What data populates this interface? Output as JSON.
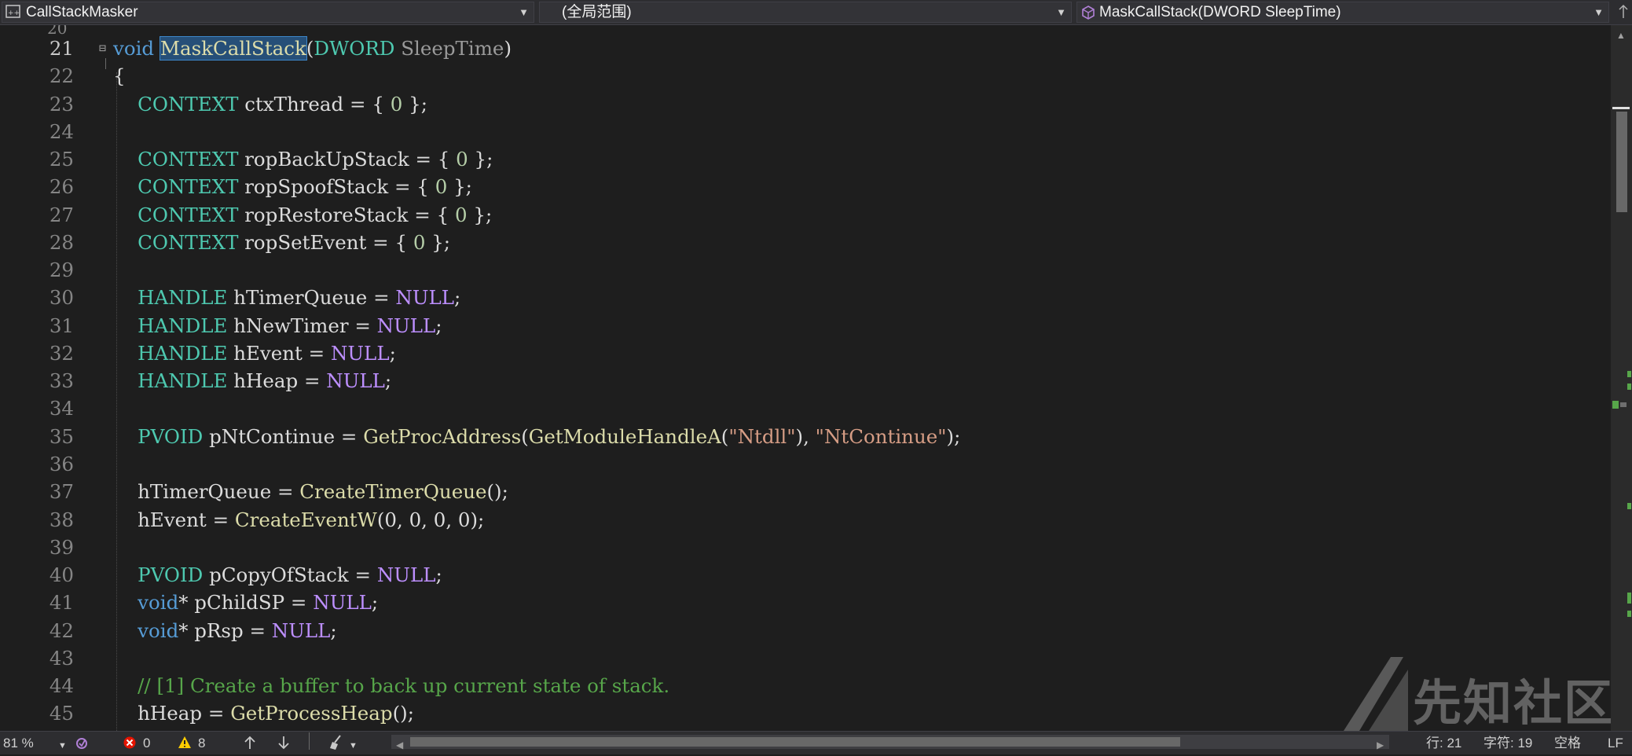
{
  "navbar": {
    "project": "CallStackMasker",
    "scope": "(全局范围)",
    "member": "MaskCallStack(DWORD SleepTime)",
    "project_icon": "cpp-project-icon",
    "member_icon": "method-cube-icon",
    "dropdown_icon": "chevron-down-icon"
  },
  "editor": {
    "current_line": 21,
    "lines": [
      {
        "num": "21",
        "tokens": [
          {
            "c": "kw",
            "t": "void "
          },
          {
            "c": "fn sel",
            "t": "MaskCallStack"
          },
          {
            "c": "pl",
            "t": "("
          },
          {
            "c": "ty",
            "t": "DWORD "
          },
          {
            "c": "pm",
            "t": "SleepTime"
          },
          {
            "c": "pl",
            "t": ")"
          }
        ]
      },
      {
        "num": "22",
        "tokens": [
          {
            "c": "pl",
            "t": "{"
          }
        ]
      },
      {
        "num": "23",
        "tokens": [
          {
            "c": "ty",
            "t": "    CONTEXT "
          },
          {
            "c": "pl",
            "t": "ctxThread = { "
          },
          {
            "c": "nm",
            "t": "0"
          },
          {
            "c": "pl",
            "t": " };"
          }
        ]
      },
      {
        "num": "24",
        "tokens": []
      },
      {
        "num": "25",
        "tokens": [
          {
            "c": "ty",
            "t": "    CONTEXT "
          },
          {
            "c": "pl",
            "t": "ropBackUpStack = { "
          },
          {
            "c": "nm",
            "t": "0"
          },
          {
            "c": "pl",
            "t": " };"
          }
        ]
      },
      {
        "num": "26",
        "tokens": [
          {
            "c": "ty",
            "t": "    CONTEXT "
          },
          {
            "c": "pl",
            "t": "ropSpoofStack = { "
          },
          {
            "c": "nm",
            "t": "0"
          },
          {
            "c": "pl",
            "t": " };"
          }
        ]
      },
      {
        "num": "27",
        "tokens": [
          {
            "c": "ty",
            "t": "    CONTEXT "
          },
          {
            "c": "pl",
            "t": "ropRestoreStack = { "
          },
          {
            "c": "nm",
            "t": "0"
          },
          {
            "c": "pl",
            "t": " };"
          }
        ]
      },
      {
        "num": "28",
        "tokens": [
          {
            "c": "ty",
            "t": "    CONTEXT "
          },
          {
            "c": "pl",
            "t": "ropSetEvent = { "
          },
          {
            "c": "nm",
            "t": "0"
          },
          {
            "c": "pl",
            "t": " };"
          }
        ]
      },
      {
        "num": "29",
        "tokens": []
      },
      {
        "num": "30",
        "tokens": [
          {
            "c": "ty",
            "t": "    HANDLE "
          },
          {
            "c": "pl",
            "t": "hTimerQueue = "
          },
          {
            "c": "mc",
            "t": "NULL"
          },
          {
            "c": "pl",
            "t": ";"
          }
        ]
      },
      {
        "num": "31",
        "tokens": [
          {
            "c": "ty",
            "t": "    HANDLE "
          },
          {
            "c": "pl",
            "t": "hNewTimer = "
          },
          {
            "c": "mc",
            "t": "NULL"
          },
          {
            "c": "pl",
            "t": ";"
          }
        ]
      },
      {
        "num": "32",
        "tokens": [
          {
            "c": "ty",
            "t": "    HANDLE "
          },
          {
            "c": "pl",
            "t": "hEvent = "
          },
          {
            "c": "mc",
            "t": "NULL"
          },
          {
            "c": "pl",
            "t": ";"
          }
        ]
      },
      {
        "num": "33",
        "tokens": [
          {
            "c": "ty",
            "t": "    HANDLE "
          },
          {
            "c": "pl",
            "t": "hHeap = "
          },
          {
            "c": "mc",
            "t": "NULL"
          },
          {
            "c": "pl",
            "t": ";"
          }
        ]
      },
      {
        "num": "34",
        "tokens": []
      },
      {
        "num": "35",
        "tokens": [
          {
            "c": "ty",
            "t": "    PVOID "
          },
          {
            "c": "pl",
            "t": "pNtContinue = "
          },
          {
            "c": "fn",
            "t": "GetProcAddress"
          },
          {
            "c": "pl",
            "t": "("
          },
          {
            "c": "fn",
            "t": "GetModuleHandleA"
          },
          {
            "c": "pl",
            "t": "("
          },
          {
            "c": "st",
            "t": "\"Ntdll\""
          },
          {
            "c": "pl",
            "t": "), "
          },
          {
            "c": "st",
            "t": "\"NtContinue\""
          },
          {
            "c": "pl",
            "t": ");"
          }
        ]
      },
      {
        "num": "36",
        "tokens": []
      },
      {
        "num": "37",
        "tokens": [
          {
            "c": "pl",
            "t": "    hTimerQueue = "
          },
          {
            "c": "fn",
            "t": "CreateTimerQueue"
          },
          {
            "c": "pl",
            "t": "();"
          }
        ]
      },
      {
        "num": "38",
        "tokens": [
          {
            "c": "pl",
            "t": "    hEvent = "
          },
          {
            "c": "fn",
            "t": "CreateEventW"
          },
          {
            "c": "pl",
            "t": "(0, 0, 0, 0);"
          }
        ]
      },
      {
        "num": "39",
        "tokens": []
      },
      {
        "num": "40",
        "tokens": [
          {
            "c": "ty",
            "t": "    PVOID "
          },
          {
            "c": "pl",
            "t": "pCopyOfStack = "
          },
          {
            "c": "mc",
            "t": "NULL"
          },
          {
            "c": "pl",
            "t": ";"
          }
        ]
      },
      {
        "num": "41",
        "tokens": [
          {
            "c": "kw",
            "t": "    void"
          },
          {
            "c": "pl",
            "t": "* pChildSP = "
          },
          {
            "c": "mc",
            "t": "NULL"
          },
          {
            "c": "pl",
            "t": ";"
          }
        ]
      },
      {
        "num": "42",
        "tokens": [
          {
            "c": "kw",
            "t": "    void"
          },
          {
            "c": "pl",
            "t": "* pRsp = "
          },
          {
            "c": "mc",
            "t": "NULL"
          },
          {
            "c": "pl",
            "t": ";"
          }
        ]
      },
      {
        "num": "43",
        "tokens": []
      },
      {
        "num": "44",
        "tokens": [
          {
            "c": "cm",
            "t": "    // [1] Create a buffer to back up current state of stack."
          }
        ]
      },
      {
        "num": "45",
        "tokens": [
          {
            "c": "pl",
            "t": "    hHeap = "
          },
          {
            "c": "fn",
            "t": "GetProcessHeap"
          },
          {
            "c": "pl",
            "t": "();"
          }
        ]
      }
    ]
  },
  "statusbar": {
    "zoom": "81 %",
    "errors": "0",
    "warnings": "8",
    "line_col_line": "行: 21",
    "line_col_char": "字符: 19",
    "whitespace": "空格",
    "line_ending": "LF"
  },
  "watermark": {
    "text": "先知社区"
  }
}
